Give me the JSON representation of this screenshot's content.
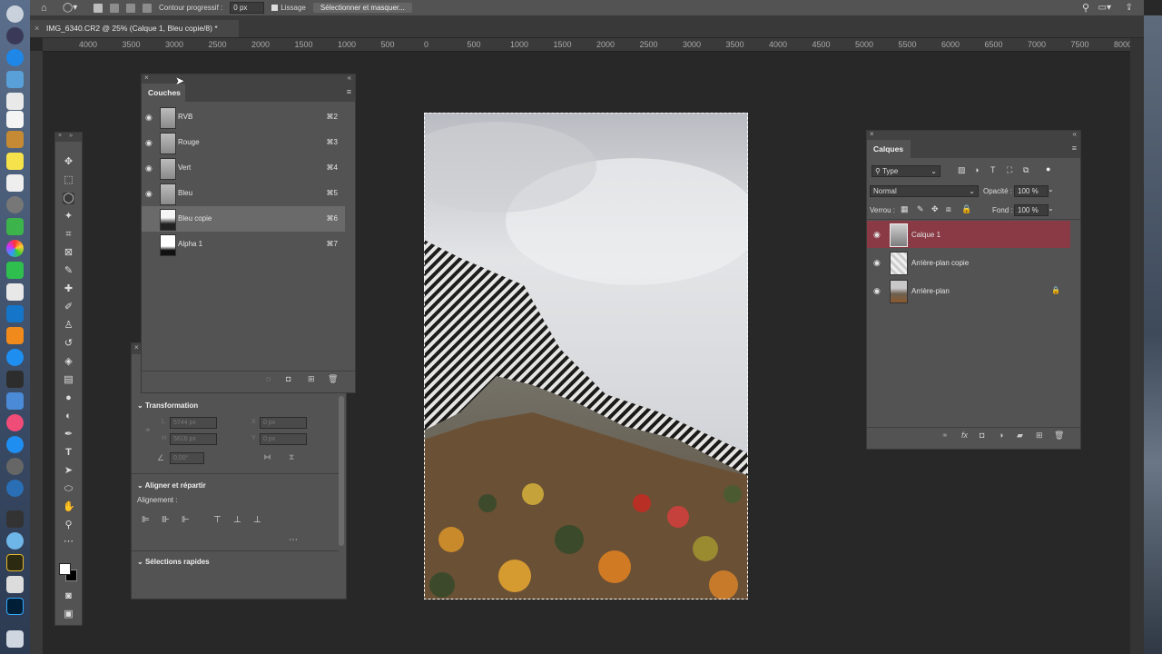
{
  "options_bar": {
    "feather_label": "Contour progressif :",
    "feather_value": "0 px",
    "smoothing_label": "Lissage",
    "select_mask_button": "Sélectionner et masquer..."
  },
  "document": {
    "tab_title": "IMG_6340.CR2 @ 25% (Calque 1, Bleu copie/8) *"
  },
  "ruler": {
    "labels": [
      "4000",
      "3500",
      "3000",
      "2500",
      "2000",
      "1500",
      "1000",
      "500",
      "0",
      "500",
      "1000",
      "1500",
      "2000",
      "2500",
      "3000",
      "3500",
      "4000",
      "4500",
      "5000",
      "5500",
      "6000",
      "6500",
      "7000",
      "7500",
      "8000"
    ]
  },
  "channels_panel": {
    "title": "Couches",
    "channels": [
      {
        "name": "RVB",
        "shortcut": "⌘2"
      },
      {
        "name": "Rouge",
        "shortcut": "⌘3"
      },
      {
        "name": "Vert",
        "shortcut": "⌘4"
      },
      {
        "name": "Bleu",
        "shortcut": "⌘5"
      },
      {
        "name": "Bleu copie",
        "shortcut": "⌘6"
      },
      {
        "name": "Alpha 1",
        "shortcut": "⌘7"
      }
    ]
  },
  "properties_panel": {
    "transform_title": "Transformation",
    "w_label": "L",
    "w_value": "5744 px",
    "x_label": "X",
    "x_value": "0 px",
    "h_label": "H",
    "h_value": "5616 px",
    "y_label": "Y",
    "y_value": "0 px",
    "angle_value": "0,00°",
    "align_title": "Aligner et répartir",
    "align_label": "Alignement :",
    "quick_title": "Sélections rapides"
  },
  "layers_panel": {
    "title": "Calques",
    "filter_type": "Type",
    "blend_mode": "Normal",
    "opacity_label": "Opacité :",
    "opacity_value": "100 %",
    "lock_label": "Verrou :",
    "fill_label": "Fond :",
    "fill_value": "100 %",
    "layers": [
      {
        "name": "Calque 1"
      },
      {
        "name": "Arrière-plan copie"
      },
      {
        "name": "Arrière-plan"
      }
    ]
  },
  "colors": {
    "accent_layer": "#8a3a44"
  }
}
